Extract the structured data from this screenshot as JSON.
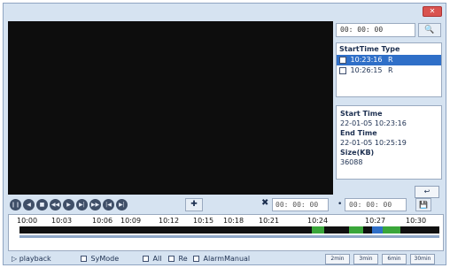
{
  "window": {
    "close_label": "✕"
  },
  "search": {
    "time_value": "00: 00: 00",
    "search_icon": "search-icon"
  },
  "list": {
    "header": "StartTime Type",
    "records": [
      {
        "time": "10:23:16",
        "type": "R",
        "selected": true
      },
      {
        "time": "10:26:15",
        "type": "R",
        "selected": false
      }
    ]
  },
  "info": {
    "start_label": "Start Time",
    "start_value": "22-01-05 10:23:16",
    "end_label": "End Time",
    "end_value": "22-01-05 10:25:19",
    "size_label": "Size(KB)",
    "size_value": "36088"
  },
  "back_icon": "back-icon",
  "controls": {
    "buttons": [
      "pause-icon",
      "step-back-icon",
      "stop-icon",
      "slow-icon",
      "play-icon",
      "step-forward-icon",
      "fast-icon",
      "previous-icon",
      "next-icon"
    ],
    "start_time": "00: 00: 00",
    "end_time": "00: 00: 00",
    "separator": "•",
    "move_icon": "move-icon",
    "cut_icon": "cut-icon",
    "save_icon": "save-icon"
  },
  "timeline": {
    "ticks": [
      "10:00",
      "10:03",
      "10:06",
      "10:09",
      "10:12",
      "10:15",
      "10:18",
      "10:21",
      "10:24",
      "10:27",
      "10:30"
    ],
    "segments": [
      {
        "start": "10:23",
        "end": "10:24",
        "color": "#3aa63a"
      },
      {
        "start": "10:25",
        "end": "10:26",
        "color": "#3aa63a"
      },
      {
        "start": "10:27",
        "end": "10:28",
        "color": "#3aa63a"
      },
      {
        "start": "10:26",
        "end": "10:27",
        "color": "#2f6fc8"
      }
    ]
  },
  "status": {
    "playback_label": "playback",
    "symode_label": "SyMode",
    "all_label": "All",
    "re_label": "Re",
    "alarm_label": "AlarmManual",
    "zoom_buttons": [
      "2min",
      "3min",
      "6min",
      "30min"
    ]
  }
}
